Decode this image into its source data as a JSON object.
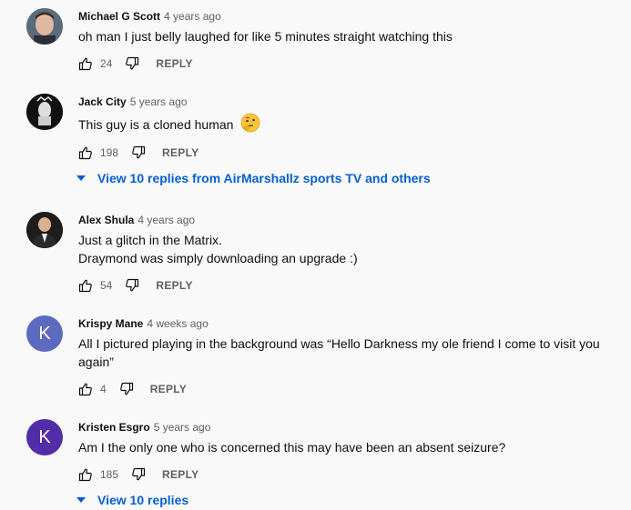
{
  "comments": [
    {
      "author": "Michael G Scott",
      "time": "4 years ago",
      "lines": [
        "oh man I just belly laughed for like 5 minutes straight watching this"
      ],
      "likes": "24",
      "reply_label": "REPLY"
    },
    {
      "author": "Jack City",
      "time": "5 years ago",
      "lines": [
        "This guy is a cloned human"
      ],
      "emoji": "thinking-face-emoji",
      "likes": "198",
      "reply_label": "REPLY",
      "view_replies": "View 10 replies from AirMarshallz sports TV and others"
    },
    {
      "author": "Alex Shula",
      "time": "4 years ago",
      "lines": [
        "Just a glitch in the Matrix.",
        "Draymond was simply downloading an upgrade :)"
      ],
      "likes": "54",
      "reply_label": "REPLY"
    },
    {
      "author": "Krispy Mane",
      "time": "4 weeks ago",
      "avatar_letter": "K",
      "avatar_color": "#5c6bc0",
      "lines": [
        "All I pictured playing in the background was “Hello Darkness my ole friend I come to visit you",
        "again”"
      ],
      "likes": "4",
      "reply_label": "REPLY"
    },
    {
      "author": "Kristen Esgro",
      "time": "5 years ago",
      "avatar_letter": "K",
      "avatar_color": "#512da8",
      "lines": [
        "Am I the only one who is concerned this may have been an absent seizure?"
      ],
      "likes": "185",
      "reply_label": "REPLY",
      "view_replies": "View 10 replies"
    }
  ],
  "colors": {
    "background": "#f9f9f9",
    "link": "#065fd4",
    "secondary_text": "#606060"
  }
}
